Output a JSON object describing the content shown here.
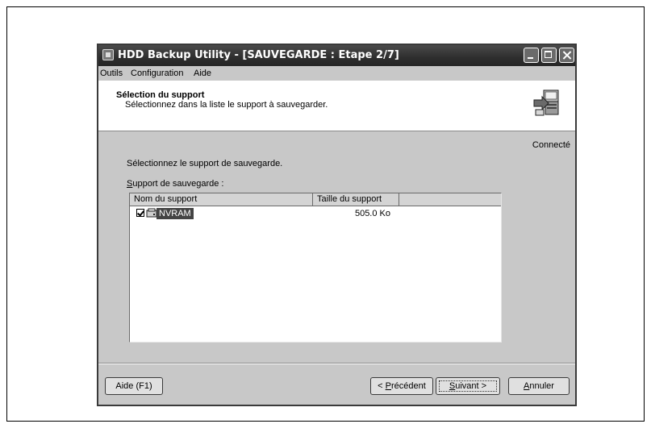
{
  "window": {
    "title": "HDD Backup Utility - [SAUVEGARDE : Etape 2/7]"
  },
  "menu": {
    "items": [
      "Outils",
      "Configuration",
      "Aide"
    ]
  },
  "header": {
    "title": "Sélection du support",
    "subtitle": "Sélectionnez dans la liste le support à sauvegarder.",
    "icon": "backup-computer-icon"
  },
  "status": "Connecté",
  "prompt": "Sélectionnez le support de sauvegarde.",
  "list": {
    "label_prefix": "S",
    "label_rest": "upport de sauvegarde :",
    "columns": [
      "Nom du support",
      "Taille du support",
      ""
    ],
    "rows": [
      {
        "checked": true,
        "icon": "drive-icon",
        "name": "NVRAM",
        "size": "505.0 Ko"
      }
    ]
  },
  "buttons": {
    "help": "Aide (F1)",
    "prev_prefix": "< ",
    "prev_underline": "P",
    "prev_rest": "récédent",
    "next_underline": "S",
    "next_rest": "uivant >",
    "cancel_underline": "A",
    "cancel_rest": "nnuler"
  },
  "colors": {
    "titlebar": "#2e2e2e",
    "dialog": "#c8c8c8",
    "selection": "#444444"
  }
}
